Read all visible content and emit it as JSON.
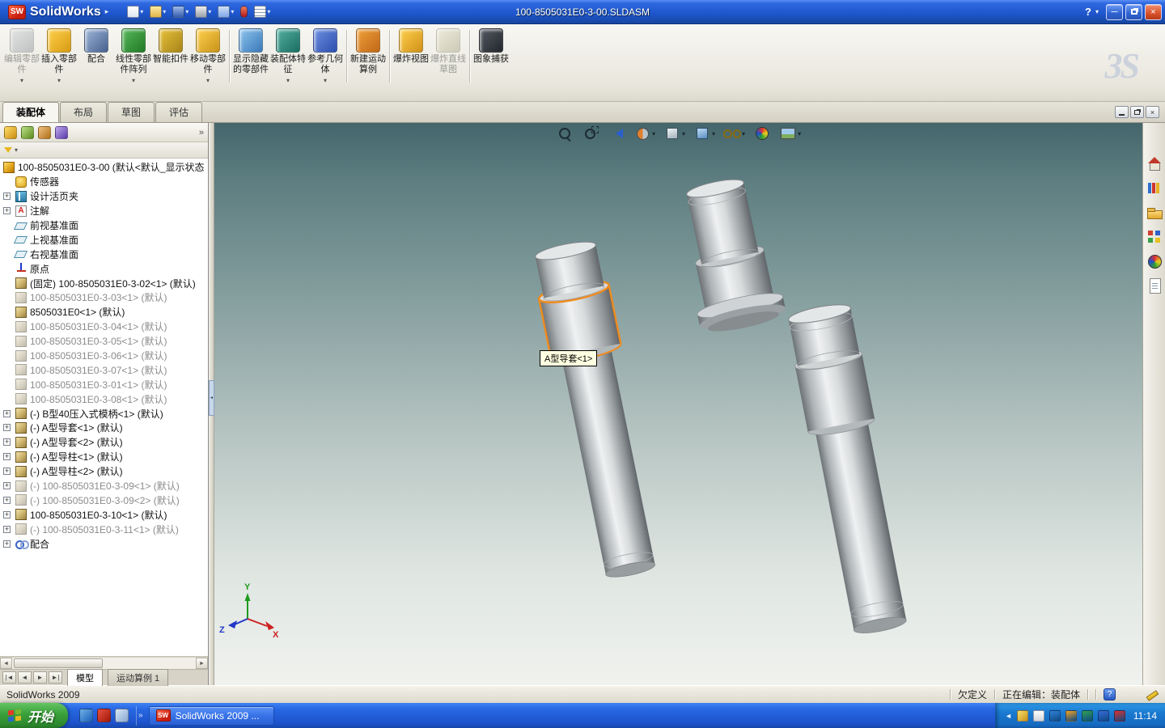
{
  "titlebar": {
    "app": "SolidWorks",
    "logo_badge": "SW",
    "doc": "100-8505031E0-3-00.SLDASM",
    "help": "?"
  },
  "quick_toolbar": [
    {
      "name": "new-document",
      "kind": "new",
      "arrow": true
    },
    {
      "name": "open-document",
      "kind": "open",
      "arrow": true
    },
    {
      "name": "save-document",
      "kind": "save",
      "arrow": true
    },
    {
      "name": "print-document",
      "kind": "print",
      "arrow": true
    },
    {
      "name": "undo",
      "kind": "undo",
      "arrow": true
    },
    {
      "name": "select",
      "kind": "select",
      "arrow": false
    },
    {
      "name": "options",
      "kind": "options",
      "arrow": true
    }
  ],
  "command_manager": {
    "buttons": [
      {
        "label": "编辑零部件",
        "name": "edit-component",
        "dim": true,
        "c1": "#cdd3da",
        "c2": "#8d97a3",
        "arrow": true
      },
      {
        "label": "插入零部件",
        "name": "insert-component",
        "c1": "#ffd24d",
        "c2": "#d89a12",
        "arrow": true
      },
      {
        "label": "配合",
        "name": "mate",
        "c1": "#9fb6d8",
        "c2": "#46618f",
        "arrow": false
      },
      {
        "label": "线性零部件阵列",
        "name": "linear-component-pattern",
        "c1": "#59b85c",
        "c2": "#1f7a24",
        "arrow": true
      },
      {
        "label": "智能扣件",
        "name": "smart-fasteners",
        "c1": "#e8c23a",
        "c2": "#a8841a",
        "arrow": false
      },
      {
        "label": "移动零部件",
        "name": "move-component",
        "c1": "#ffd24d",
        "c2": "#c8921a",
        "arrow": true
      },
      {
        "label": "显示隐藏的零部件",
        "name": "show-hidden-components",
        "sep_before": true,
        "c1": "#8ec6ef",
        "c2": "#3a78b8",
        "arrow": false
      },
      {
        "label": "装配体特征",
        "name": "assembly-features",
        "c1": "#54b0a0",
        "c2": "#1a6e62",
        "arrow": true
      },
      {
        "label": "参考几何体",
        "name": "reference-geometry",
        "c1": "#6f8fe0",
        "c2": "#2b4fae",
        "arrow": true
      },
      {
        "label": "新建运动算例",
        "name": "new-motion-study",
        "sep_before": true,
        "c1": "#f0a03a",
        "c2": "#c06818",
        "arrow": false
      },
      {
        "label": "爆炸视图",
        "name": "exploded-view",
        "sep_before": true,
        "c1": "#ffd24d",
        "c2": "#d09018",
        "arrow": false
      },
      {
        "label": "爆炸直线草图",
        "name": "explode-line-sketch",
        "dim": true,
        "c1": "#e8e0b8",
        "c2": "#b0a870",
        "arrow": false
      },
      {
        "label": "图象捕获",
        "name": "image-capture",
        "sep_before": true,
        "c1": "#555b63",
        "c2": "#22262c",
        "arrow": false
      }
    ],
    "tabs": [
      {
        "label": "装配体",
        "name": "tab-assembly",
        "active": true
      },
      {
        "label": "布局",
        "name": "tab-layout",
        "active": false
      },
      {
        "label": "草图",
        "name": "tab-sketch",
        "active": false
      },
      {
        "label": "评估",
        "name": "tab-evaluate",
        "active": false
      }
    ]
  },
  "feature_tree": {
    "items": [
      {
        "t": "100-8505031E0-3-00 (默认<默认_显示状态",
        "i": "asm",
        "root": true
      },
      {
        "t": "传感器",
        "i": "sensor"
      },
      {
        "t": "设计活页夹",
        "i": "binder",
        "e": true
      },
      {
        "t": "注解",
        "i": "note",
        "e": true
      },
      {
        "t": "前视基准面",
        "i": "plane"
      },
      {
        "t": "上视基准面",
        "i": "plane"
      },
      {
        "t": "右视基准面",
        "i": "plane"
      },
      {
        "t": "原点",
        "i": "origin"
      },
      {
        "t": "(固定) 100-8505031E0-3-02<1> (默认)",
        "i": "part"
      },
      {
        "t": "100-8505031E0-3-03<1> (默认)",
        "i": "part",
        "d": true
      },
      {
        "t": "8505031E0<1> (默认)",
        "i": "part"
      },
      {
        "t": "100-8505031E0-3-04<1> (默认)",
        "i": "part",
        "d": true
      },
      {
        "t": "100-8505031E0-3-05<1> (默认)",
        "i": "part",
        "d": true
      },
      {
        "t": "100-8505031E0-3-06<1> (默认)",
        "i": "part",
        "d": true
      },
      {
        "t": "100-8505031E0-3-07<1> (默认)",
        "i": "part",
        "d": true
      },
      {
        "t": "100-8505031E0-3-01<1> (默认)",
        "i": "part",
        "d": true
      },
      {
        "t": "100-8505031E0-3-08<1> (默认)",
        "i": "part",
        "d": true
      },
      {
        "t": "(-) B型40压入式模柄<1> (默认)",
        "i": "part",
        "e": true
      },
      {
        "t": "(-) A型导套<1> (默认)",
        "i": "part",
        "e": true
      },
      {
        "t": "(-) A型导套<2> (默认)",
        "i": "part",
        "e": true
      },
      {
        "t": "(-) A型导柱<1> (默认)",
        "i": "part",
        "e": true
      },
      {
        "t": "(-) A型导柱<2> (默认)",
        "i": "part",
        "e": true
      },
      {
        "t": "(-) 100-8505031E0-3-09<1> (默认)",
        "i": "part",
        "d": true,
        "e": true
      },
      {
        "t": "(-) 100-8505031E0-3-09<2> (默认)",
        "i": "part",
        "d": true,
        "e": true
      },
      {
        "t": "100-8505031E0-3-10<1> (默认)",
        "i": "part",
        "e": true
      },
      {
        "t": "(-) 100-8505031E0-3-11<1> (默认)",
        "i": "part",
        "d": true,
        "e": true
      },
      {
        "t": "配合",
        "i": "mates",
        "e": true
      }
    ]
  },
  "viewport": {
    "tooltip": "A型导套<1>",
    "selection_color": "#f08a1d",
    "triad": {
      "x": "X",
      "y": "Y",
      "z": "Z"
    },
    "hud": [
      {
        "name": "zoom-fit",
        "kind": "mag",
        "arrow": false
      },
      {
        "name": "zoom-to-area",
        "kind": "mag2",
        "arrow": false
      },
      {
        "name": "previous-view",
        "kind": "prev",
        "arrow": false
      },
      {
        "name": "section-view",
        "kind": "section",
        "arrow": true
      },
      {
        "name": "view-orientation",
        "kind": "cube",
        "arrow": true
      },
      {
        "name": "display-style",
        "kind": "cube2",
        "arrow": true
      },
      {
        "name": "hide-show-items",
        "kind": "glasses",
        "arrow": true
      },
      {
        "name": "edit-appearance",
        "kind": "ball",
        "arrow": false
      },
      {
        "name": "apply-scene",
        "kind": "scene",
        "arrow": true
      }
    ]
  },
  "task_pane": [
    {
      "name": "solidworks-resources-icon",
      "kind": "home"
    },
    {
      "name": "design-library-icon",
      "kind": "books"
    },
    {
      "name": "file-explorer-icon",
      "kind": "folder"
    },
    {
      "name": "view-palette-icon",
      "kind": "palette"
    },
    {
      "name": "appearances-scenes-icon",
      "kind": "ball"
    },
    {
      "name": "custom-properties-icon",
      "kind": "doc"
    }
  ],
  "bottom_bar": {
    "model_tab": "模型",
    "motion_tab": "运动算例 1"
  },
  "status_bar": {
    "app_version": "SolidWorks 2009",
    "definition": "欠定义",
    "editing": "正在编辑：装配体",
    "badge": "?"
  },
  "taskbar": {
    "start": "开始",
    "task_button": "SolidWorks 2009 ...",
    "clock": "11:14",
    "quick_launch": [
      {
        "name": "internet-explorer-icon",
        "c1": "#6fb0e8",
        "c2": "#1a60b8"
      },
      {
        "name": "solidworks-shortcut-icon",
        "c1": "#e85040",
        "c2": "#a01808"
      },
      {
        "name": "show-desktop-icon",
        "c1": "#d8e8f8",
        "c2": "#88a8d0"
      }
    ],
    "tray": [
      {
        "name": "ime-pen-icon",
        "kind": "pen"
      },
      {
        "name": "ime-keyboard-icon",
        "kind": "keyboard"
      },
      {
        "name": "tray-icon-1",
        "c": "#2f7fd8"
      },
      {
        "name": "tray-icon-2",
        "c": "#f0a020"
      },
      {
        "name": "tray-icon-3",
        "c": "#30a050"
      },
      {
        "name": "tray-icon-4",
        "c": "#3868d8"
      },
      {
        "name": "tray-icon-5",
        "c": "#d83030"
      }
    ]
  }
}
